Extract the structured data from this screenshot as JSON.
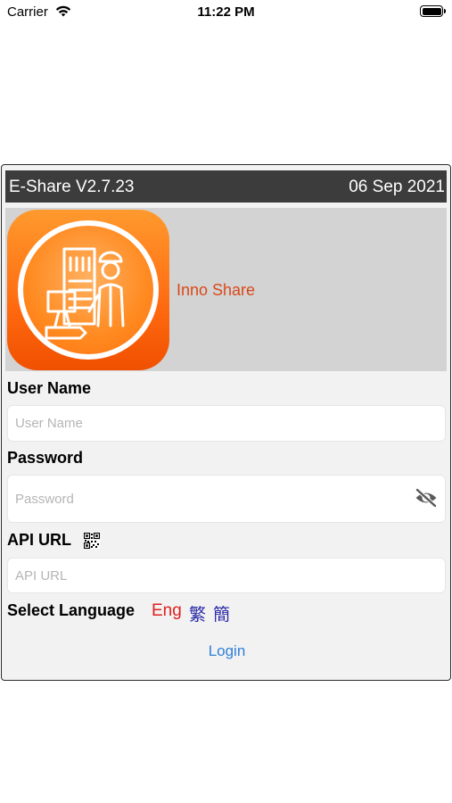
{
  "status_bar": {
    "carrier": "Carrier",
    "time": "11:22 PM"
  },
  "header": {
    "app_version": "E-Share V2.7.23",
    "date": "06 Sep 2021"
  },
  "brand": {
    "name": "Inno Share"
  },
  "form": {
    "username": {
      "label": "User Name",
      "placeholder": "User Name",
      "value": ""
    },
    "password": {
      "label": "Password",
      "placeholder": "Password",
      "value": ""
    },
    "api_url": {
      "label": "API URL",
      "placeholder": "API URL",
      "value": ""
    }
  },
  "language": {
    "label": "Select Language",
    "options": [
      {
        "label": "Eng",
        "color": "#e02020",
        "selected": true
      },
      {
        "label": "繁",
        "color": "#2a2aa8",
        "selected": false
      },
      {
        "label": "簡",
        "color": "#2a2aa8",
        "selected": false
      }
    ]
  },
  "actions": {
    "login_label": "Login"
  },
  "colors": {
    "header_bg": "#3c3c3c",
    "banner_bg": "#d3d3d3",
    "brand_text": "#d9481a",
    "link_blue": "#2e7fd8",
    "logo_orange": "#ff7010"
  },
  "icons": [
    "wifi-icon",
    "battery-icon",
    "app-logo",
    "eye-off-icon",
    "qr-code-icon"
  ]
}
